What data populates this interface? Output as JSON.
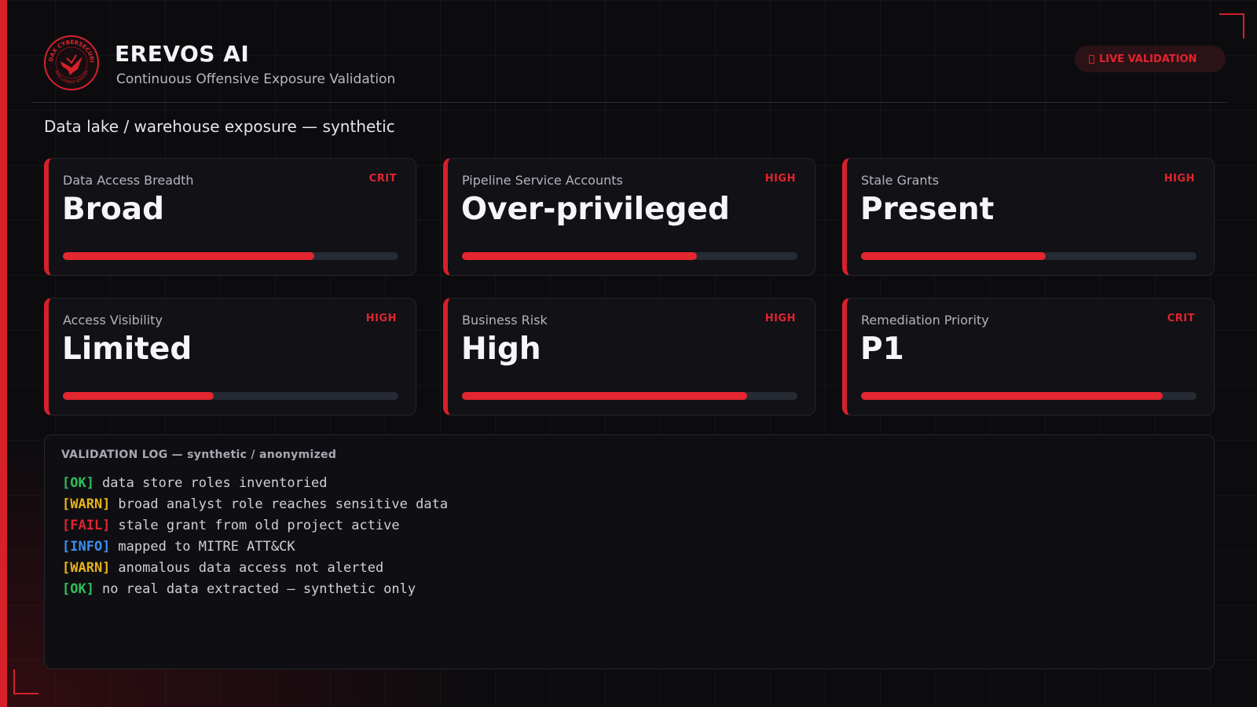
{
  "header": {
    "title": "EREVOS AI",
    "subtitle": "Continuous Offensive Exposure Validation",
    "badge": "LIVE VALIDATION",
    "logo_icon": "eagle-seal-icon",
    "logo_ring_text": "AUDAX CYBERSECURITY",
    "logo_ring_text_bottom": "INTELLIGENCE SERVICES"
  },
  "section": {
    "title": "Data lake / warehouse exposure — synthetic"
  },
  "colors": {
    "accent": "#d6202a",
    "ok": "#2fbf5a",
    "warn": "#e8b21a",
    "fail": "#e0242e",
    "info": "#3d8ef0"
  },
  "cards": [
    {
      "label": "Data Access Breadth",
      "severity": "CRIT",
      "value": "Broad",
      "level": 0.75
    },
    {
      "label": "Pipeline Service Accounts",
      "severity": "HIGH",
      "value": "Over-privileged",
      "level": 0.7
    },
    {
      "label": "Stale Grants",
      "severity": "HIGH",
      "value": "Present",
      "level": 0.55
    },
    {
      "label": "Access Visibility",
      "severity": "HIGH",
      "value": "Limited",
      "level": 0.45
    },
    {
      "label": "Business Risk",
      "severity": "HIGH",
      "value": "High",
      "level": 0.85
    },
    {
      "label": "Remediation Priority",
      "severity": "CRIT",
      "value": "P1",
      "level": 0.9
    }
  ],
  "log": {
    "title": "VALIDATION LOG — synthetic / anonymized",
    "lines": [
      {
        "tag": "[OK]",
        "level": "ok",
        "text": "data store roles inventoried"
      },
      {
        "tag": "[WARN]",
        "level": "warn",
        "text": "broad analyst role reaches sensitive data"
      },
      {
        "tag": "[FAIL]",
        "level": "fail",
        "text": "stale grant from old project active"
      },
      {
        "tag": "[INFO]",
        "level": "info",
        "text": "mapped to MITRE ATT&CK"
      },
      {
        "tag": "[WARN]",
        "level": "warn",
        "text": "anomalous data access not alerted"
      },
      {
        "tag": "[OK]",
        "level": "ok",
        "text": "no real data extracted — synthetic only"
      }
    ]
  }
}
